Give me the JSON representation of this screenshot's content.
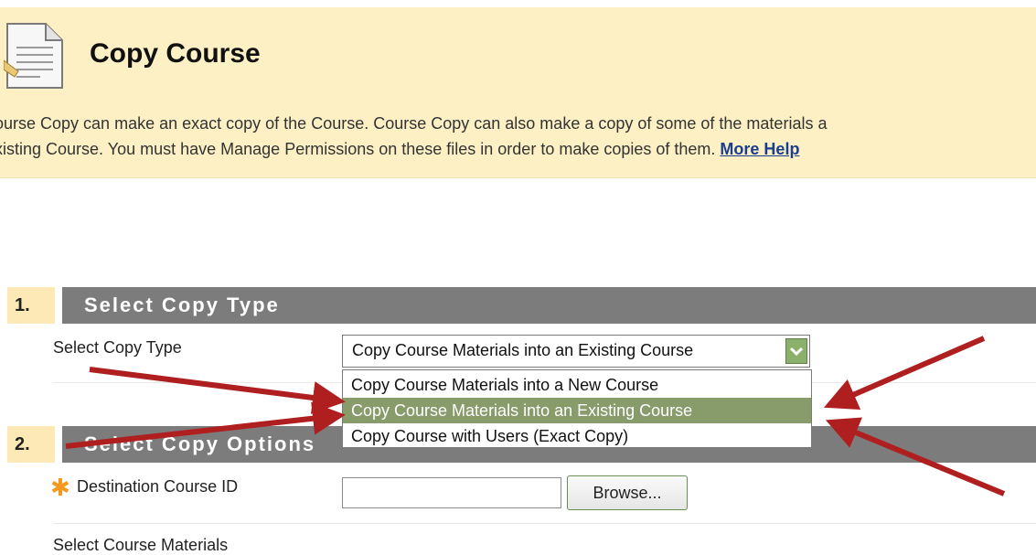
{
  "header": {
    "title": "Copy Course",
    "description_line1": "ourse Copy can make an exact copy of the Course. Course Copy can also make a copy of some of the materials a",
    "description_line2": "xisting Course. You must have Manage Permissions on these files in order to make copies of them.",
    "more_help_link": "More Help"
  },
  "step1": {
    "number": "1.",
    "title": "Select Copy Type",
    "field_label": "Select Copy Type",
    "selected_value": "Copy Course Materials into an Existing Course",
    "options": [
      "Copy Course Materials into a New Course",
      "Copy Course Materials into an Existing Course",
      "Copy Course with Users (Exact Copy)"
    ]
  },
  "step2": {
    "number": "2.",
    "title": "Select Copy Options",
    "destination_label": "Destination Course ID",
    "destination_value": "",
    "browse_label": "Browse...",
    "materials_label": "Select Course Materials"
  },
  "colors": {
    "header_bg": "#fcf0c4",
    "section_bar": "#7c7c7c",
    "highlight_option": "#889b6a",
    "annotation_arrow": "#b01f1f",
    "required_star": "#f39a1e",
    "link": "#1a3d8f"
  },
  "icons": [
    "document-icon",
    "chevron-down-icon",
    "required-star-icon",
    "annotation-arrow"
  ]
}
